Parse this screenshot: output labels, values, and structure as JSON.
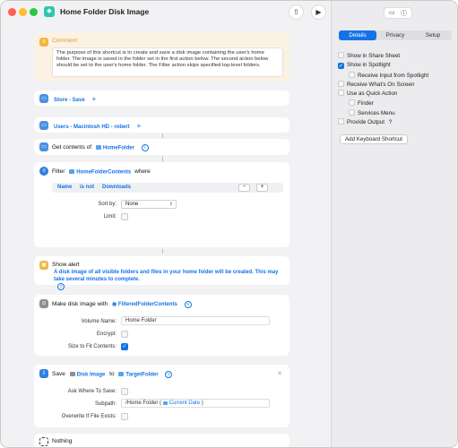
{
  "window": {
    "title": "Home Folder Disk Image"
  },
  "comment": {
    "title": "Comment",
    "text": "The purpose of this shortcut is to create and save a disk image containing the user's home folder. The image is saved in the folder set in the first action below. The second action below should be set to the user's home folder. The Filter action skips specified top-level folders."
  },
  "actions": {
    "store": {
      "label": "Store - Save"
    },
    "users": {
      "label": "Users - Macintosh HD - robert"
    },
    "get_contents": {
      "prefix": "Get contents of",
      "var": "HomeFolder"
    },
    "filter": {
      "prefix": "Filter",
      "var": "HomeFolderContents",
      "suffix": "where",
      "cond_field": "Name",
      "cond_op": "is not",
      "cond_value": "Downloads",
      "sort_label": "Sort by:",
      "sort_value": "None",
      "limit_label": "Limit:"
    },
    "alert": {
      "prefix": "Show alert",
      "message": "A disk image of all visible folders and files in your home folder will be created. This may take several minutes to complete."
    },
    "disk_image": {
      "prefix": "Make disk image with",
      "var": "FilteredFolderContents",
      "volume_label": "Volume Name:",
      "volume_value": "Home Folder",
      "encrypt_label": "Encrypt:",
      "size_label": "Size to Fit Contents:"
    },
    "save": {
      "prefix": "Save",
      "var": "Disk Image",
      "to": "to",
      "target": "TargetFolder",
      "ask_label": "Ask Where To Save:",
      "subpath_label": "Subpath:",
      "subpath_value": "/Home Folder (",
      "subpath_var": "Current Date",
      "subpath_end": ")",
      "overwrite_label": "Overwrite If File Exists:"
    },
    "nothing": {
      "label": "Nothing"
    }
  },
  "sidebar": {
    "tabs": [
      "Details",
      "Privacy",
      "Setup"
    ],
    "active_tab": "Details",
    "options": [
      {
        "label": "Show in Share Sheet",
        "checked": false
      },
      {
        "label": "Show in Spotlight",
        "checked": true
      },
      {
        "label": "Receive Input from Spotlight",
        "checked": false
      },
      {
        "label": "Receive What's On Screen",
        "checked": false
      },
      {
        "label": "Use as Quick Action",
        "checked": false
      },
      {
        "label": "Finder",
        "checked": false
      },
      {
        "label": "Services Menu",
        "checked": false
      },
      {
        "label": "Provide Output",
        "checked": false
      }
    ],
    "provide_output_help": "?",
    "add_shortcut_label": "Add Keyboard Shortcut"
  },
  "colors": {
    "accent": "#1473e6",
    "comment_bg": "#fbf2e4"
  }
}
